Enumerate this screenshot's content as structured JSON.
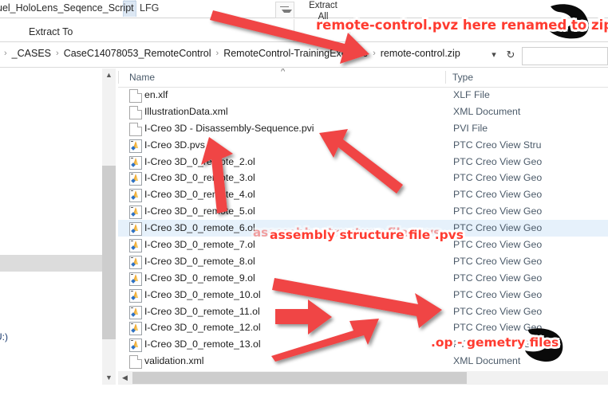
{
  "window": {
    "ribbon": {
      "tab_truncated_label": "uel_HoloLens_Seqence_Script",
      "tab_lfg_label": "LFG",
      "collapse_icon": "chevron-down-icon",
      "extract_group_title": "Extract",
      "extract_group_subtitle": "All",
      "extract_to_label": "Extract To"
    },
    "address_bar": {
      "breadcrumbs": [
        "_CASES",
        "CaseC14078053_RemoteControl",
        "RemoteControl-TrainingExercise",
        "remote-control.zip"
      ],
      "separator": "›",
      "dropdown_icon": "chevron-down-icon",
      "refresh_icon": "refresh-icon",
      "search_placeholder": ""
    },
    "navigation_pane": {
      "visible_label": "(U:)",
      "scroll_up_icon": "chevron-up-icon",
      "scroll_down_icon": "chevron-down-icon"
    },
    "file_list": {
      "columns": [
        {
          "key": "name",
          "label": "Name",
          "sorted": true,
          "sort_icon": "caret-up-icon"
        },
        {
          "key": "type",
          "label": "Type"
        }
      ],
      "rows": [
        {
          "name": "en.xlf",
          "type": "XLF File",
          "icon": "document-icon",
          "selected": false
        },
        {
          "name": "IllustrationData.xml",
          "type": "XML Document",
          "icon": "document-icon",
          "selected": false
        },
        {
          "name": "I-Creo 3D - Disassembly-Sequence.pvi",
          "type": "PVI File",
          "icon": "document-icon",
          "selected": false
        },
        {
          "name": "I-Creo 3D.pvs",
          "type": "PTC Creo View Stru",
          "icon": "creo-view-icon",
          "selected": false
        },
        {
          "name": "I-Creo 3D_0_remote_2.ol",
          "type": "PTC Creo View Geo",
          "icon": "creo-view-icon",
          "selected": false
        },
        {
          "name": "I-Creo 3D_0_remote_3.ol",
          "type": "PTC Creo View Geo",
          "icon": "creo-view-icon",
          "selected": false
        },
        {
          "name": "I-Creo 3D_0_remote_4.ol",
          "type": "PTC Creo View Geo",
          "icon": "creo-view-icon",
          "selected": false
        },
        {
          "name": "I-Creo 3D_0_remote_5.ol",
          "type": "PTC Creo View Geo",
          "icon": "creo-view-icon",
          "selected": false
        },
        {
          "name": "I-Creo 3D_0_remote_6.ol",
          "type": "PTC Creo View Geo",
          "icon": "creo-view-icon",
          "selected": true
        },
        {
          "name": "I-Creo 3D_0_remote_7.ol",
          "type": "PTC Creo View Geo",
          "icon": "creo-view-icon",
          "selected": false
        },
        {
          "name": "I-Creo 3D_0_remote_8.ol",
          "type": "PTC Creo View Geo",
          "icon": "creo-view-icon",
          "selected": false
        },
        {
          "name": "I-Creo 3D_0_remote_9.ol",
          "type": "PTC Creo View Geo",
          "icon": "creo-view-icon",
          "selected": false
        },
        {
          "name": "I-Creo 3D_0_remote_10.ol",
          "type": "PTC Creo View Geo",
          "icon": "creo-view-icon",
          "selected": false
        },
        {
          "name": "I-Creo 3D_0_remote_11.ol",
          "type": "PTC Creo View Geo",
          "icon": "creo-view-icon",
          "selected": false
        },
        {
          "name": "I-Creo 3D_0_remote_12.ol",
          "type": "PTC Creo View Geo",
          "icon": "creo-view-icon",
          "selected": false
        },
        {
          "name": "I-Creo 3D_0_remote_13.ol",
          "type": "PTC Creo View Geo",
          "icon": "creo-view-icon",
          "selected": false
        },
        {
          "name": "validation.xml",
          "type": "XML Document",
          "icon": "document-icon",
          "selected": false
        }
      ],
      "horizontal_scroll_left_icon": "chevron-left-icon"
    }
  },
  "annotations": {
    "color": "#ff3b30",
    "texts": [
      {
        "id": "zip-note",
        "text": "remote-control.pvz here renamed to zip"
      },
      {
        "id": "pvs-note",
        "text": "assembly structure file .pvs"
      },
      {
        "id": "pvs-note-ghost",
        "text": "assembly structure file .pvs"
      },
      {
        "id": "ol-note",
        "text": ".op - gemetry files"
      }
    ],
    "arrow_count": 6,
    "arrow_color": "#f04545"
  }
}
